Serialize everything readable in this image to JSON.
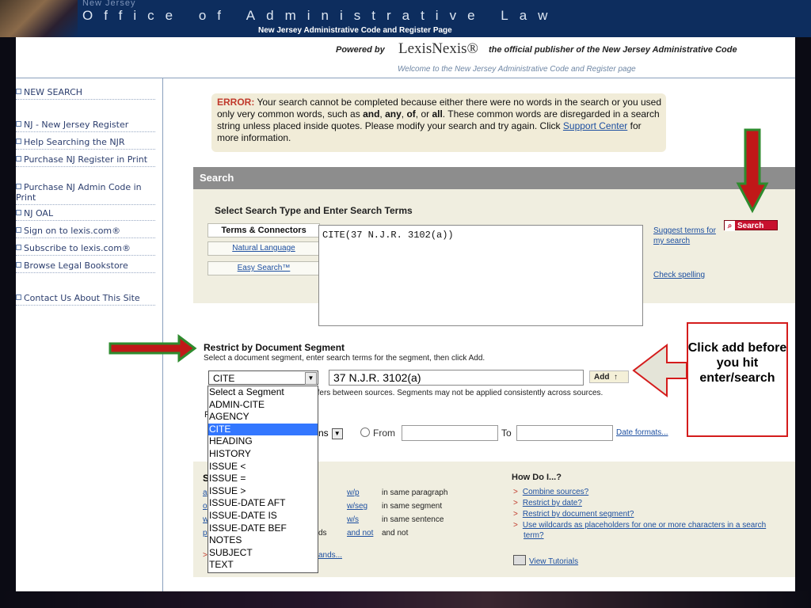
{
  "banner": {
    "small_title": "New Jersey",
    "big_title": "Office of Administrative Law",
    "subtitle": "New Jersey Administrative Code and Register Page"
  },
  "header": {
    "powered_by": "Powered by",
    "lexis": "LexisNexis®",
    "official": "the official publisher of the New Jersey Administrative Code",
    "welcome": "Welcome to the New Jersey Administrative Code and Register page"
  },
  "sidebar": {
    "items": [
      {
        "label": "NEW SEARCH"
      },
      {
        "label": "NJ - New Jersey Register"
      },
      {
        "label": "Help Searching the NJR"
      },
      {
        "label": "Purchase NJ Register in Print"
      },
      {
        "label": "Purchase NJ Admin Code in Print"
      },
      {
        "label": "NJ OAL"
      },
      {
        "label": "Sign on to lexis.com®"
      },
      {
        "label": "Subscribe to lexis.com®"
      },
      {
        "label": "Browse Legal Bookstore"
      },
      {
        "label": "Contact Us About This Site"
      }
    ]
  },
  "error": {
    "label": "ERROR:",
    "text1": " Your search cannot be completed because either there were no words in the search or you used only very common words, such as ",
    "and": "and",
    "c1": ", ",
    "any": "any",
    "c2": ", ",
    "of": "of",
    "c3": ", or ",
    "all": "all",
    "text2": ". These common words are disregarded in a search string unless placed inside quotes. Please modify your search and try again. Click ",
    "link": "Support Center",
    "text3": " for more information."
  },
  "search": {
    "bar_title": "Search",
    "select_title": "Select Search Type and Enter Search Terms",
    "types": [
      "Terms & Connectors",
      "Natural Language",
      "Easy Search™"
    ],
    "query": "CITE(37 N.J.R. 3102(a))",
    "suggest": "Suggest terms for my search",
    "check_spelling": "Check spelling",
    "button": "Search"
  },
  "restrict": {
    "title": "Restrict by Document Segment",
    "help": "Select a document segment, enter search terms for the segment, then click Add.",
    "selected_segment": "CITE",
    "term": "37 N.J.R. 3102(a)",
    "add": "Add",
    "note": "ffers between sources. Segments may not be applied consistently across sources.",
    "note_cont": "R",
    "date_select": "ns",
    "from": "From",
    "to": "To",
    "date_formats": "Date formats..."
  },
  "dropdown": {
    "options": [
      "Select a Segment",
      "ADMIN-CITE",
      "AGENCY",
      "CITE",
      "HEADING",
      "HISTORY",
      "ISSUE <",
      "ISSUE =",
      "ISSUE >",
      "ISSUE-DATE AFT",
      "ISSUE-DATE IS",
      "ISSUE-DATE BEF",
      "NOTES",
      "SUBJECT",
      "TEXT"
    ],
    "selected_index": 3
  },
  "connectors": {
    "heading_stub": "S",
    "rows": [
      {
        "stub": "a",
        "code": "w/p",
        "desc": "in same paragraph"
      },
      {
        "stub": "o",
        "code": "w/seg",
        "desc": "in same segment"
      },
      {
        "stub": "w",
        "code": "w/s",
        "desc": "in same sentence"
      },
      {
        "stub": "p",
        "code": "and not",
        "desc": "and not",
        "extra": "ds"
      }
    ],
    "more_stub": ">",
    "more": "ands..."
  },
  "howdo": {
    "title": "How Do I...?",
    "items": [
      "Combine sources?",
      "Restrict by date?",
      "Restrict by document segment?",
      "Use wildcards as placeholders for one or more characters in a search",
      "term?"
    ],
    "tutorials": "View Tutorials"
  },
  "callout": {
    "text": "Click add before you hit enter/search"
  },
  "colors": {
    "banner": "#0d2d5e",
    "arrow_red": "#d41c1c",
    "arrow_green": "#2e8b2e",
    "callout_fill": "#e4e4d8"
  }
}
